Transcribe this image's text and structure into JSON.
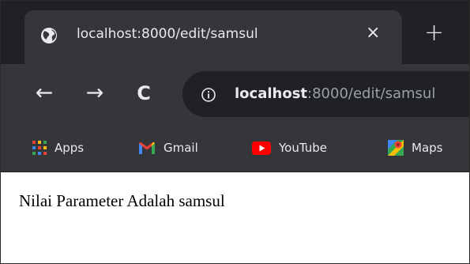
{
  "tab": {
    "title": "localhost:8000/edit/samsul",
    "close_glyph": "×",
    "favicon": "globe-icon"
  },
  "new_tab": {
    "glyph": "+",
    "icon": "plus-icon"
  },
  "toolbar": {
    "back_glyph": "←",
    "forward_glyph": "→",
    "reload_glyph": "C",
    "url_host": "localhost",
    "url_rest": ":8000/edit/samsul",
    "info_icon": "info-icon"
  },
  "bookmarks": [
    {
      "label": "Apps",
      "icon": "apps-grid-icon"
    },
    {
      "label": "Gmail",
      "icon": "gmail-icon"
    },
    {
      "label": "YouTube",
      "icon": "youtube-icon"
    },
    {
      "label": "Maps",
      "icon": "maps-icon"
    }
  ],
  "page": {
    "text": "Nilai Parameter Adalah samsul"
  },
  "colors": {
    "tabstrip_bg": "#202124",
    "toolbar_bg": "#35363a",
    "omnibox_bg": "#202124",
    "text_light": "#e8eaed",
    "text_muted": "#9aa0a6"
  }
}
